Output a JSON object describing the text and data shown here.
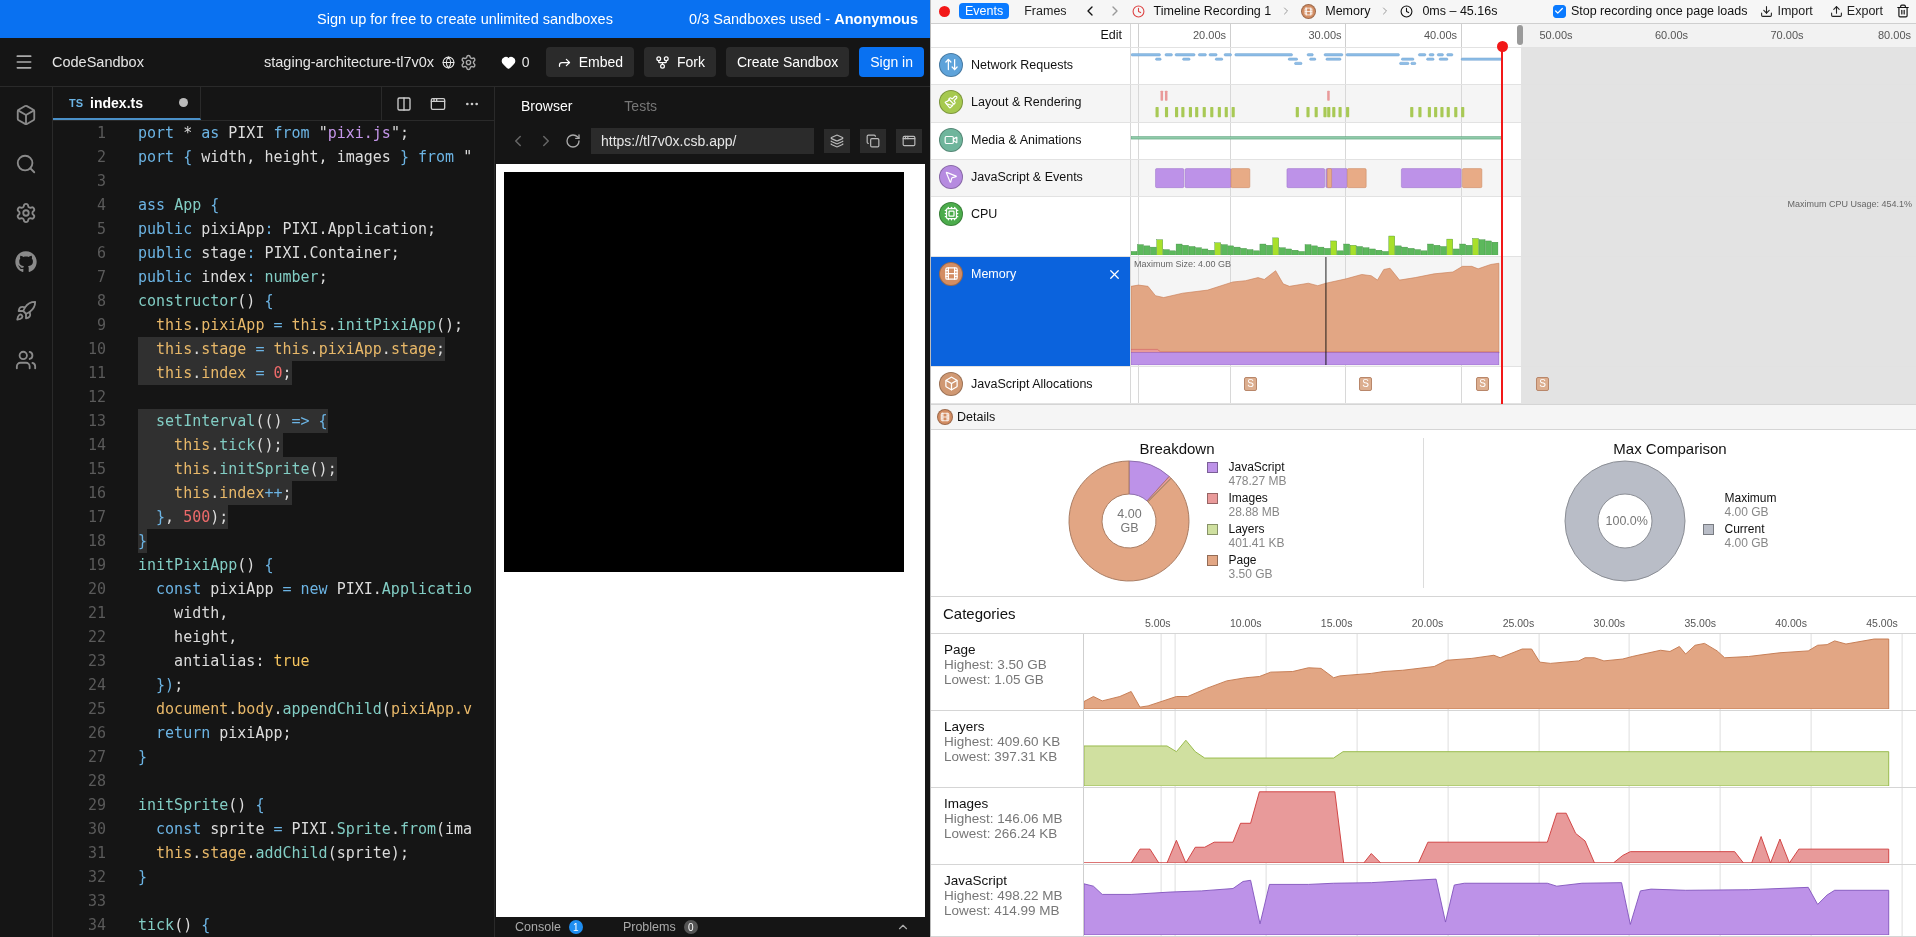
{
  "banner": {
    "message": "Sign up for free to create unlimited sandboxes",
    "usage": "0/3 Sandboxes used - **Anonymous**"
  },
  "header": {
    "brand": "CodeSandbox",
    "sandbox_title": "staging-architecture-tl7v0x",
    "likes": "0",
    "buttons": [
      {
        "label": "Embed",
        "kind": "embed"
      },
      {
        "label": "Fork",
        "kind": "fork"
      },
      {
        "label": "Create Sandbox",
        "kind": "plain"
      },
      {
        "label": "Sign in",
        "kind": "primary"
      }
    ]
  },
  "activity_bar": {
    "items": [
      {
        "kind": "cube"
      },
      {
        "kind": "search"
      },
      {
        "kind": "settings"
      },
      {
        "kind": "github"
      },
      {
        "kind": "rocket"
      },
      {
        "kind": "users"
      }
    ]
  },
  "editor": {
    "tab": {
      "badge": "TS",
      "filename": "index.ts",
      "unsaved": true
    },
    "lines": [
      {
        "number": "1",
        "highlighted": false,
        "tokens": [
          {
            "text": "port ",
            "kind": "kw"
          },
          {
            "text": "* ",
            "kind": "pl"
          },
          {
            "text": "as ",
            "kind": "kw"
          },
          {
            "text": "PIXI ",
            "kind": "pl"
          },
          {
            "text": "from ",
            "kind": "kw"
          },
          {
            "text": "\"",
            "kind": "pl"
          },
          {
            "text": "pixi.js",
            "kind": "str"
          },
          {
            "text": "\";",
            "kind": "pl"
          }
        ]
      },
      {
        "number": "2",
        "highlighted": false,
        "tokens": [
          {
            "text": "port ",
            "kind": "kw"
          },
          {
            "text": "{ ",
            "kind": "kw"
          },
          {
            "text": "width, height, images ",
            "kind": "pl"
          },
          {
            "text": "} ",
            "kind": "kw"
          },
          {
            "text": "from ",
            "kind": "kw"
          },
          {
            "text": "\"",
            "kind": "pl"
          }
        ]
      },
      {
        "number": "3"
      },
      {
        "number": "4",
        "highlighted": false,
        "tokens": [
          {
            "text": "ass ",
            "kind": "kw"
          },
          {
            "text": "App ",
            "kind": "fn"
          },
          {
            "text": "{",
            "kind": "kw"
          }
        ]
      },
      {
        "number": "5",
        "highlighted": false,
        "tokens": [
          {
            "text": "public ",
            "kind": "kw"
          },
          {
            "text": "pixiApp",
            "kind": "pl"
          },
          {
            "text": ": ",
            "kind": "kw"
          },
          {
            "text": "PIXI.Application;",
            "kind": "pl"
          }
        ]
      },
      {
        "number": "6",
        "highlighted": false,
        "tokens": [
          {
            "text": "public ",
            "kind": "kw"
          },
          {
            "text": "stage",
            "kind": "pl"
          },
          {
            "text": ": ",
            "kind": "kw"
          },
          {
            "text": "PIXI.Container;",
            "kind": "pl"
          }
        ]
      },
      {
        "number": "7",
        "highlighted": false,
        "tokens": [
          {
            "text": "public ",
            "kind": "kw"
          },
          {
            "text": "index",
            "kind": "pl"
          },
          {
            "text": ": ",
            "kind": "kw"
          },
          {
            "text": "number",
            "kind": "fn"
          },
          {
            "text": ";",
            "kind": "pl"
          }
        ]
      },
      {
        "number": "8",
        "highlighted": false,
        "tokens": [
          {
            "text": "constructor",
            "kind": "fn"
          },
          {
            "text": "() ",
            "kind": "pl"
          },
          {
            "text": "{",
            "kind": "kw"
          }
        ]
      },
      {
        "number": "9",
        "highlighted": false,
        "tokens": [
          {
            "text": "  this",
            "kind": "th"
          },
          {
            "text": ".",
            "kind": "pl"
          },
          {
            "text": "pixiApp",
            "kind": "th"
          },
          {
            "text": " = ",
            "kind": "kw"
          },
          {
            "text": "this",
            "kind": "th"
          },
          {
            "text": ".",
            "kind": "pl"
          },
          {
            "text": "initPixiApp",
            "kind": "fn"
          },
          {
            "text": "();",
            "kind": "pl"
          }
        ]
      },
      {
        "number": "10",
        "highlighted": true,
        "tokens": [
          {
            "text": "  this",
            "kind": "th"
          },
          {
            "text": ".",
            "kind": "pl"
          },
          {
            "text": "stage",
            "kind": "th"
          },
          {
            "text": " = ",
            "kind": "kw"
          },
          {
            "text": "this",
            "kind": "th"
          },
          {
            "text": ".",
            "kind": "pl"
          },
          {
            "text": "pixiApp",
            "kind": "th"
          },
          {
            "text": ".",
            "kind": "pl"
          },
          {
            "text": "stage",
            "kind": "th"
          },
          {
            "text": ";",
            "kind": "pl"
          }
        ]
      },
      {
        "number": "11",
        "highlighted": true,
        "tokens": [
          {
            "text": "  this",
            "kind": "th"
          },
          {
            "text": ".",
            "kind": "pl"
          },
          {
            "text": "index",
            "kind": "th"
          },
          {
            "text": " = ",
            "kind": "kw"
          },
          {
            "text": "0",
            "kind": "num"
          },
          {
            "text": ";",
            "kind": "pl"
          }
        ]
      },
      {
        "number": "12"
      },
      {
        "number": "13",
        "highlighted": true,
        "tokens": [
          {
            "text": "  setInterval",
            "kind": "fn"
          },
          {
            "text": "(() ",
            "kind": "pl"
          },
          {
            "text": "=> {",
            "kind": "kw"
          }
        ]
      },
      {
        "number": "14",
        "highlighted": true,
        "tokens": [
          {
            "text": "    this",
            "kind": "th"
          },
          {
            "text": ".",
            "kind": "pl"
          },
          {
            "text": "tick",
            "kind": "fn"
          },
          {
            "text": "();",
            "kind": "pl"
          }
        ]
      },
      {
        "number": "15",
        "highlighted": true,
        "tokens": [
          {
            "text": "    this",
            "kind": "th"
          },
          {
            "text": ".",
            "kind": "pl"
          },
          {
            "text": "initSprite",
            "kind": "fn"
          },
          {
            "text": "();",
            "kind": "pl"
          }
        ]
      },
      {
        "number": "16",
        "highlighted": true,
        "tokens": [
          {
            "text": "    this",
            "kind": "th"
          },
          {
            "text": ".",
            "kind": "pl"
          },
          {
            "text": "index",
            "kind": "th"
          },
          {
            "text": "++",
            "kind": "kw"
          },
          {
            "text": ";",
            "kind": "pl"
          }
        ]
      },
      {
        "number": "17",
        "highlighted": true,
        "tokens": [
          {
            "text": "  }",
            "kind": "kw"
          },
          {
            "text": ", ",
            "kind": "pl"
          },
          {
            "text": "500",
            "kind": "num"
          },
          {
            "text": ");",
            "kind": "pl"
          }
        ]
      },
      {
        "number": "18",
        "highlighted": true,
        "tokens": [
          {
            "text": "}",
            "kind": "kw"
          }
        ]
      },
      {
        "number": "19",
        "highlighted": false,
        "tokens": [
          {
            "text": "initPixiApp",
            "kind": "fn"
          },
          {
            "text": "() ",
            "kind": "pl"
          },
          {
            "text": "{",
            "kind": "kw"
          }
        ]
      },
      {
        "number": "20",
        "highlighted": false,
        "tokens": [
          {
            "text": "  const ",
            "kind": "kw"
          },
          {
            "text": "pixiApp ",
            "kind": "pl"
          },
          {
            "text": "= ",
            "kind": "kw"
          },
          {
            "text": "new ",
            "kind": "kw"
          },
          {
            "text": "PIXI.",
            "kind": "pl"
          },
          {
            "text": "Applicatio",
            "kind": "fn"
          }
        ]
      },
      {
        "number": "21",
        "highlighted": false,
        "tokens": [
          {
            "text": "    width,",
            "kind": "pl"
          }
        ]
      },
      {
        "number": "22",
        "highlighted": false,
        "tokens": [
          {
            "text": "    height,",
            "kind": "pl"
          }
        ]
      },
      {
        "number": "23",
        "highlighted": false,
        "tokens": [
          {
            "text": "    antialias: ",
            "kind": "pl"
          },
          {
            "text": "true",
            "kind": "lit"
          }
        ]
      },
      {
        "number": "24",
        "highlighted": false,
        "tokens": [
          {
            "text": "  })",
            "kind": "kw"
          },
          {
            "text": ";",
            "kind": "pl"
          }
        ]
      },
      {
        "number": "25",
        "highlighted": false,
        "tokens": [
          {
            "text": "  document",
            "kind": "th"
          },
          {
            "text": ".",
            "kind": "pl"
          },
          {
            "text": "body",
            "kind": "th"
          },
          {
            "text": ".",
            "kind": "pl"
          },
          {
            "text": "appendChild",
            "kind": "fn"
          },
          {
            "text": "(",
            "kind": "pl"
          },
          {
            "text": "pixiApp",
            "kind": "th"
          },
          {
            "text": ".v",
            "kind": "th"
          }
        ]
      },
      {
        "number": "26",
        "highlighted": false,
        "tokens": [
          {
            "text": "  return ",
            "kind": "kw"
          },
          {
            "text": "pixiApp;",
            "kind": "pl"
          }
        ]
      },
      {
        "number": "27",
        "highlighted": false,
        "tokens": [
          {
            "text": "}",
            "kind": "kw"
          }
        ]
      },
      {
        "number": "28"
      },
      {
        "number": "29",
        "highlighted": false,
        "tokens": [
          {
            "text": "initSprite",
            "kind": "fn"
          },
          {
            "text": "() ",
            "kind": "pl"
          },
          {
            "text": "{",
            "kind": "kw"
          }
        ]
      },
      {
        "number": "30",
        "highlighted": false,
        "tokens": [
          {
            "text": "  const ",
            "kind": "kw"
          },
          {
            "text": "sprite ",
            "kind": "pl"
          },
          {
            "text": "= ",
            "kind": "kw"
          },
          {
            "text": "PIXI.",
            "kind": "pl"
          },
          {
            "text": "Sprite",
            "kind": "fn"
          },
          {
            "text": ".",
            "kind": "pl"
          },
          {
            "text": "from",
            "kind": "fn"
          },
          {
            "text": "(ima",
            "kind": "pl"
          }
        ]
      },
      {
        "number": "31",
        "highlighted": false,
        "tokens": [
          {
            "text": "  this",
            "kind": "th"
          },
          {
            "text": ".",
            "kind": "pl"
          },
          {
            "text": "stage",
            "kind": "th"
          },
          {
            "text": ".",
            "kind": "pl"
          },
          {
            "text": "addChild",
            "kind": "fn"
          },
          {
            "text": "(sprite);",
            "kind": "pl"
          }
        ]
      },
      {
        "number": "32",
        "highlighted": false,
        "tokens": [
          {
            "text": "}",
            "kind": "kw"
          }
        ]
      },
      {
        "number": "33"
      },
      {
        "number": "34",
        "highlighted": false,
        "tokens": [
          {
            "text": "tick",
            "kind": "fn"
          },
          {
            "text": "() ",
            "kind": "pl"
          },
          {
            "text": "{",
            "kind": "kw"
          }
        ]
      }
    ]
  },
  "browser": {
    "tabs": [
      {
        "label": "Browser",
        "selected": true
      },
      {
        "label": "Tests",
        "selected": false
      }
    ],
    "url": "https://tl7v0x.csb.app/",
    "bottom_tabs": [
      {
        "label": "Console",
        "count": "1",
        "color": "#1f8ef1"
      },
      {
        "label": "Problems",
        "count": "0",
        "color": "#555555"
      }
    ]
  },
  "timeline": {
    "toolbar": {
      "recording": true,
      "modes": [
        {
          "label": "Events",
          "selected": true
        },
        {
          "label": "Frames",
          "selected": false
        }
      ],
      "breadcrumbs": [
        {
          "label": "Timeline Recording 1",
          "kind": "recording"
        },
        {
          "label": "Memory",
          "kind": "memory"
        },
        {
          "label": "0ms – 45.16s",
          "kind": "range"
        }
      ],
      "stop_option": {
        "label": "Stop recording once page loads",
        "checked": true
      },
      "actions": [
        {
          "label": "Import",
          "kind": "import"
        },
        {
          "label": "Export",
          "kind": "export"
        }
      ]
    },
    "ruler": {
      "edit_label": "Edit",
      "ticks": [
        "20.00s",
        "30.00s",
        "40.00s",
        "50.00s",
        "60.00s",
        "70.00s",
        "80.00s"
      ]
    },
    "tracks": [
      {
        "kind": "network",
        "label": "Network Requests",
        "color": "#5ea3da",
        "selected": false
      },
      {
        "kind": "layout",
        "label": "Layout & Rendering",
        "color": "#a6c94f",
        "selected": false
      },
      {
        "kind": "media",
        "label": "Media & Animations",
        "color": "#6fb59c",
        "selected": false
      },
      {
        "kind": "script",
        "label": "JavaScript & Events",
        "color": "#b68be0",
        "selected": false
      },
      {
        "kind": "cpu",
        "label": "CPU",
        "color": "#4cac4c",
        "selected": false,
        "note": "Maximum CPU Usage: 454.1%"
      },
      {
        "kind": "memory",
        "label": "Memory",
        "color": "#d38d63",
        "selected": true,
        "note": "Maximum Size: 4.00 GB"
      },
      {
        "kind": "allocations",
        "label": "JavaScript Allocations",
        "color": "#d09872",
        "selected": false,
        "markers": [
          "S",
          "S",
          "S",
          "S"
        ]
      }
    ],
    "details_label": "Details"
  },
  "details": {
    "breakdown": {
      "title": "Breakdown",
      "center": "4.00 GB",
      "items": [
        {
          "label": "JavaScript",
          "value": "478.27 MB",
          "color": "#bd92e8"
        },
        {
          "label": "Images",
          "value": "28.88 MB",
          "color": "#e99a9a"
        },
        {
          "label": "Layers",
          "value": "401.41 KB",
          "color": "#cfe0a0"
        },
        {
          "label": "Page",
          "value": "3.50 GB",
          "color": "#e2a684"
        }
      ]
    },
    "max_comparison": {
      "title": "Max Comparison",
      "center": "100.0%",
      "items": [
        {
          "label": "Maximum",
          "value": "4.00 GB"
        },
        {
          "label": "Current",
          "value": "4.00 GB",
          "color": "#b9bdc7"
        }
      ]
    }
  },
  "categories": {
    "title": "Categories",
    "ticks": [
      "5.00s",
      "10.00s",
      "15.00s",
      "20.00s",
      "25.00s",
      "30.00s",
      "35.00s",
      "40.00s",
      "45.00s"
    ],
    "rows": [
      {
        "kind": "page",
        "label": "Page",
        "highest": "Highest: 3.50 GB",
        "lowest": "Lowest: 1.05 GB",
        "color": "#e2a684"
      },
      {
        "kind": "layers",
        "label": "Layers",
        "highest": "Highest: 409.60 KB",
        "lowest": "Lowest: 397.31 KB",
        "color": "#d0e0a0"
      },
      {
        "kind": "images",
        "label": "Images",
        "highest": "Highest: 146.06 MB",
        "lowest": "Lowest: 266.24 KB",
        "color": "#e89a9a"
      },
      {
        "kind": "javascript",
        "label": "JavaScript",
        "highest": "Highest: 498.22 MB",
        "lowest": "Lowest: 414.99 MB",
        "color": "#bd92e8"
      }
    ]
  }
}
